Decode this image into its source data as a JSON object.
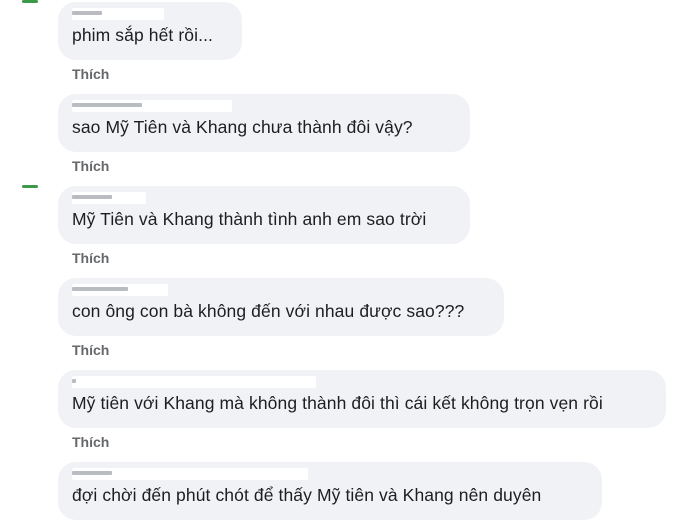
{
  "comments": [
    {
      "text": "phim sắp hết rồi...",
      "like_label": "Thích"
    },
    {
      "text": "sao Mỹ Tiên và Khang chưa thành đôi vậy?",
      "like_label": "Thích"
    },
    {
      "text": "Mỹ Tiên và Khang thành tình anh em sao trời",
      "like_label": "Thích"
    },
    {
      "text": "con ông con bà không đến với nhau được sao???",
      "like_label": "Thích"
    },
    {
      "text": "Mỹ tiên với Khang mà không thành đôi thì cái kết không trọn vẹn rồi",
      "like_label": "Thích"
    },
    {
      "text": "đợi chời đến phút chót để thấy Mỹ tiên và Khang nên duyên"
    }
  ],
  "colors": {
    "bubble": "#f0f2f5",
    "text": "#1c1e21",
    "like": "#65676b",
    "avatar_accent": "#3a9a4a"
  }
}
